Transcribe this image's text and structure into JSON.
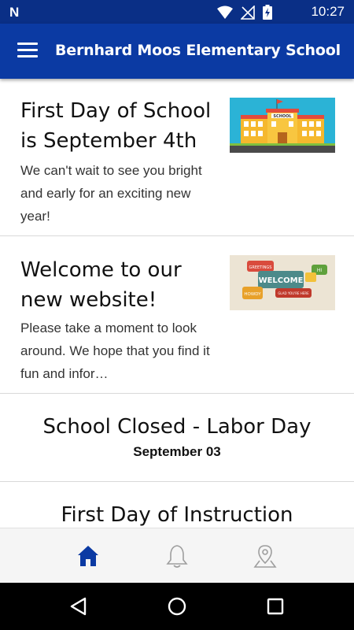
{
  "status_bar": {
    "carrier_logo": "N",
    "time": "10:27"
  },
  "app_bar": {
    "title": "Bernhard Moos Elementary School",
    "menu_icon": "hamburger-menu-icon"
  },
  "news": [
    {
      "title": "First Day of School is September 4th",
      "body": "We can't wait to see you bright and early for an exciting new year!",
      "image_label": "SCHOOL"
    },
    {
      "title": "Welcome to our new website!",
      "body": "Please take a moment to look around. We hope that you find it fun and infor…",
      "image_words": [
        "GREETINGS",
        "WELCOME",
        "HI",
        "HOWDY",
        "GLAD YOU'RE HERE"
      ]
    }
  ],
  "events": [
    {
      "title": "School Closed - Labor Day",
      "date": "September 03"
    },
    {
      "title": "First Day of Instruction",
      "date": ""
    }
  ],
  "bottom_nav": {
    "items": [
      {
        "icon": "home-icon",
        "active": true
      },
      {
        "icon": "bell-icon",
        "active": false
      },
      {
        "icon": "map-pin-icon",
        "active": false
      }
    ],
    "active_color": "#0b3aa3",
    "inactive_color": "#9e9e9e"
  },
  "colors": {
    "status_bar": "#0a2f86",
    "app_bar": "#0b3aa3"
  }
}
